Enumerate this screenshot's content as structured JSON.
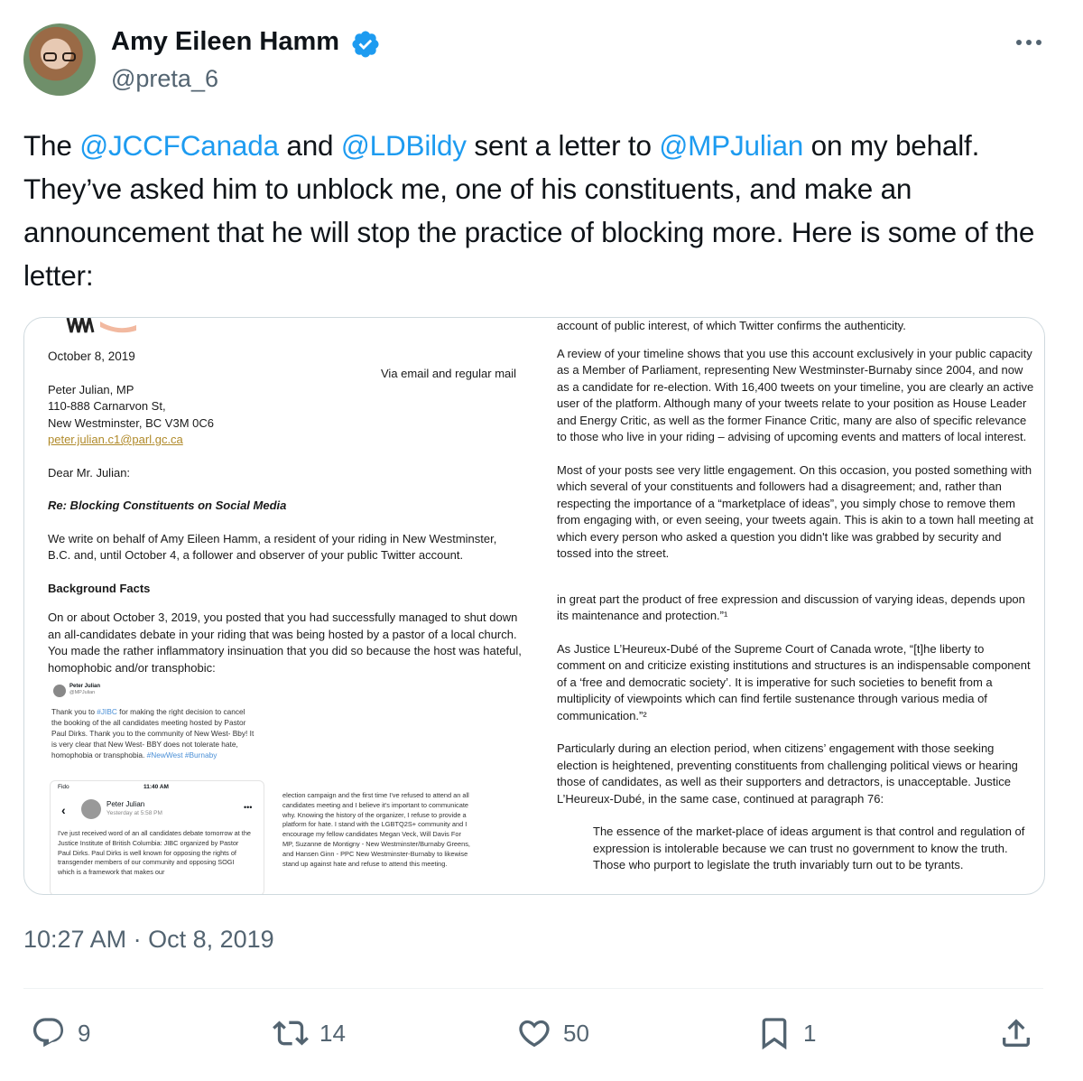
{
  "author": {
    "name": "Amy Eileen Hamm",
    "handle": "@preta_6"
  },
  "tweet": {
    "segments": [
      {
        "text": "The ",
        "type": "text"
      },
      {
        "text": "@JCCFCanada",
        "type": "mention"
      },
      {
        "text": " and ",
        "type": "text"
      },
      {
        "text": "@LDBildy",
        "type": "mention"
      },
      {
        "text": " sent a letter to ",
        "type": "text"
      },
      {
        "text": "@MPJulian",
        "type": "mention"
      },
      {
        "text": " on my behalf. They’ve asked him to unblock me, one of his constituents, and make an announcement that he will stop the practice of blocking more. Here is some of the letter:",
        "type": "text"
      }
    ],
    "timestamp": "10:27 AM · Oct 8, 2019"
  },
  "letter_left": {
    "date": "October 8, 2019",
    "via": "Via email and regular mail",
    "addr1": "Peter Julian, MP",
    "addr2": "110-888 Carnarvon St,",
    "addr3": "New Westminster, BC V3M 0C6",
    "email": "peter.julian.c1@parl.gc.ca",
    "salutation": "Dear Mr. Julian:",
    "re": "Re:  Blocking Constituents on Social Media",
    "p1": "We write on behalf of Amy Eileen Hamm, a resident of your riding in New Westminster, B.C. and, until October 4, a follower and observer of your public Twitter account.",
    "heading": "Background Facts",
    "p2": "On or about October 3, 2019, you posted that you had successfully managed to shut down an all-candidates debate in your riding that was being hosted by a pastor of a local church. You made the rather inflammatory insinuation that you did so because the host was hateful, homophobic and/or transphobic:"
  },
  "embedded_tweet": {
    "name": "Peter Julian",
    "handle": "@MPJulian",
    "text_a": "Thank you to ",
    "tag_a": "#JIBC",
    "text_b": " for making the right decision to cancel the booking of the all candidates meeting hosted by Pastor Paul Dirks. Thank you to the community of New West- Bby! It is very clear that New West- BBY does not tolerate hate, homophobia or transphobia. ",
    "tags_b": "#NewWest #Burnaby"
  },
  "embedded_fb": {
    "carrier": "Fido",
    "time": "11:40 AM",
    "name": "Peter Julian",
    "posted": "Yesterday at 5:58 PM",
    "text": "I've just received word of an all candidates debate tomorrow at the Justice Institute of British Columbia: JIBC organized by Pastor Paul Dirks. Paul Dirks is well known for opposing the rights of transgender members of our community and opposing SOGI which is a framework that makes our"
  },
  "embedded_fb_continued": "election campaign and the first time I've refused to attend an all candidates meeting and I believe it's important to communicate why. Knowing the history of the organizer, I refuse to provide a platform for hate. I stand with the LGBTQ2S+ community and I encourage my fellow candidates Megan Veck, Will Davis For MP, Suzanne de Montigny - New Westminster/Burnaby Greens, and Hansen Ginn - PPC New Westminster-Burnaby to likewise stand up against hate and refuse to attend this meeting.",
  "letter_right": {
    "top": "account of public interest, of which Twitter confirms the authenticity.",
    "p1": "A review of your timeline shows that you use this account exclusively in your public capacity as a Member of Parliament, representing New Westminster-Burnaby since 2004, and now as a candidate for re-election. With 16,400 tweets on your timeline, you are clearly an active user of the platform. Although many of your tweets relate to your position as House Leader and Energy Critic, as well as the former Finance Critic, many are also of specific relevance to those who live in your riding – advising of upcoming events and matters of local interest.",
    "p2": "Most of your posts see very little engagement. On this occasion, you posted something with which several of your constituents and followers had a disagreement; and, rather than respecting the importance of a “marketplace of ideas”, you simply chose to remove them from engaging with, or even seeing, your tweets again. This is akin to a town hall meeting at which every person who asked a question you didn't like was grabbed by security and tossed into the street.",
    "p3": "in great part the product of free expression and discussion of varying ideas, depends upon its maintenance and protection.”¹",
    "p4": "As Justice L’Heureux-Dubé of the Supreme Court of Canada wrote, “[t]he liberty to comment on and criticize existing institutions and structures is an indispensable component of a ‘free and democratic society’. It is imperative for such societies to benefit from a multiplicity of viewpoints which can find fertile sustenance through various media of communication.”²",
    "p5": "Particularly during an election period, when citizens’ engagement with those seeking election is heightened, preventing constituents from challenging political views or hearing those of candidates, as well as their supporters and detractors, is unacceptable. Justice L’Heureux-Dubé, in the same case, continued at paragraph 76:",
    "quote": "The essence of the market-place of ideas argument is that control and regulation of expression is intolerable because we can trust no government to know the truth. Those who purport to legislate the truth invariably turn out to be tyrants."
  },
  "actions": {
    "replies": "9",
    "reposts": "14",
    "likes": "50",
    "bookmarks": "1"
  },
  "colors": {
    "link": "#1d9bf0",
    "text": "#0f1419",
    "muted": "#536471",
    "verified": "#1d9bf0"
  }
}
